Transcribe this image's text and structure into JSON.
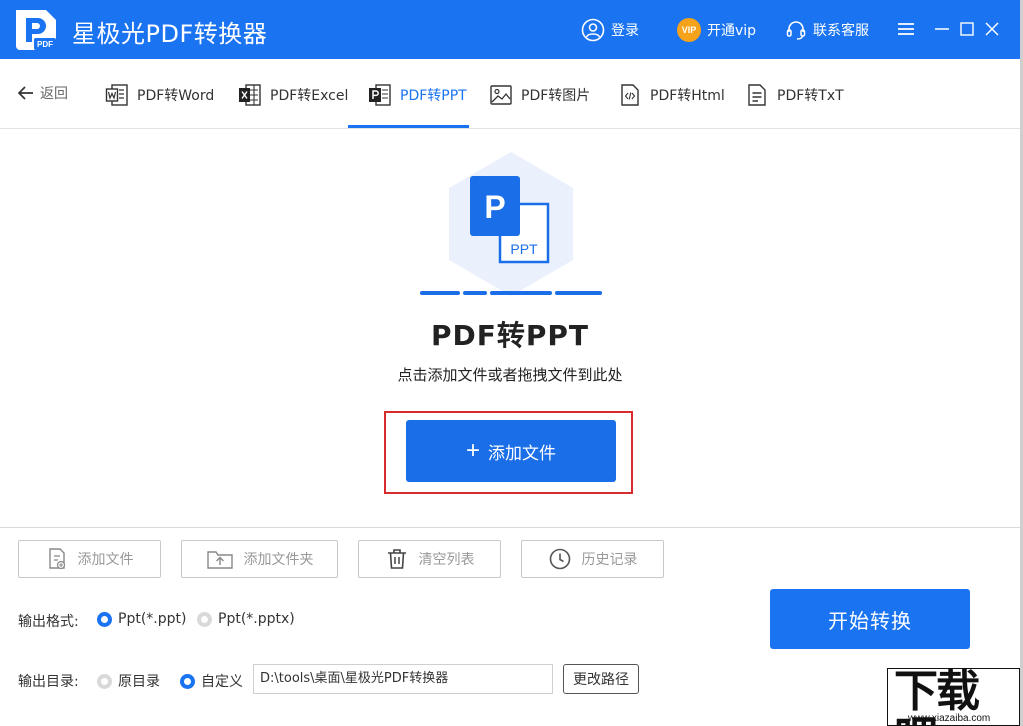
{
  "app": {
    "title": "星极光PDF转换器",
    "logo_text": "PDF"
  },
  "titlebar": {
    "login": "登录",
    "vip_badge": "VIP",
    "vip": "开通vip",
    "support": "联系客服"
  },
  "tabs": {
    "back": "返回",
    "items": [
      {
        "label": "PDF转Word",
        "icon": "word-file-icon"
      },
      {
        "label": "PDF转Excel",
        "icon": "excel-file-icon"
      },
      {
        "label": "PDF转PPT",
        "icon": "ppt-file-icon",
        "active": true
      },
      {
        "label": "PDF转图片",
        "icon": "image-icon"
      },
      {
        "label": "PDF转Html",
        "icon": "html-file-icon"
      },
      {
        "label": "PDF转TxT",
        "icon": "txt-file-icon"
      }
    ]
  },
  "hero": {
    "big_letter": "P",
    "small_label": "PPT"
  },
  "main": {
    "title": "PDF转PPT",
    "subtitle": "点击添加文件或者拖拽文件到此处",
    "add_button": "添加文件"
  },
  "toolbar": {
    "add_file": "添加文件",
    "add_folder": "添加文件夹",
    "clear_list": "清空列表",
    "history": "历史记录"
  },
  "output": {
    "format_label": "输出格式:",
    "format_options": [
      "Ppt(*.ppt)",
      "Ppt(*.pptx)"
    ],
    "dir_label": "输出目录:",
    "dir_options": [
      "原目录",
      "自定义"
    ],
    "path": "D:\\tools\\桌面\\星极光PDF转换器",
    "change_path": "更改路径"
  },
  "start_button": "开始转换",
  "watermark": {
    "main": "下载吧",
    "sub": "www.xiazaiba.com"
  },
  "colors": {
    "accent": "#1a73f0",
    "highlight": "#d82b2b",
    "vip": "#f7a21b"
  }
}
